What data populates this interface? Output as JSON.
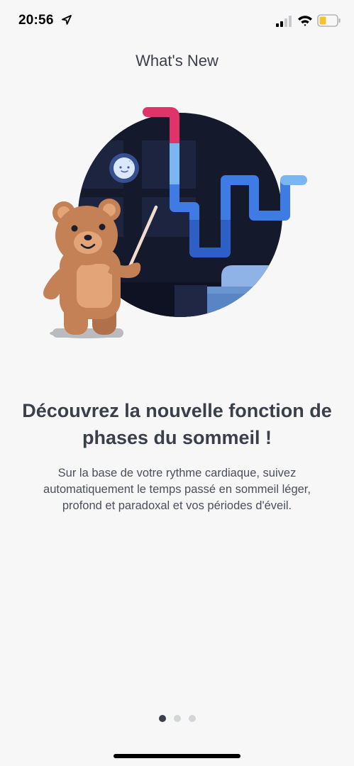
{
  "status_bar": {
    "time": "20:56",
    "icons": [
      "location-arrow-icon",
      "cellular-signal-icon",
      "wifi-icon",
      "battery-icon"
    ]
  },
  "header": {
    "title": "What's New"
  },
  "illustration": {
    "name": "teddy-bear-sleep-stages-illustration",
    "colors": {
      "night_circle": "#14192c",
      "stage_awake": "#e0336a",
      "stage_light": "#7ab7f2",
      "stage_deep": "#3f7be5",
      "stage_deepest": "#2e5fc6",
      "bear_body": "#c38155"
    }
  },
  "content": {
    "headline": "Découvrez la nouvelle fonction de phases du sommeil !",
    "description": "Sur la base de votre rythme cardiaque, suivez automatiquement le temps passé en sommeil léger, profond et paradoxal et vos périodes d'éveil."
  },
  "pager": {
    "total": 3,
    "current": 1
  },
  "theme": {
    "background": "#f7f7f8",
    "text": "#3a3f4a"
  }
}
